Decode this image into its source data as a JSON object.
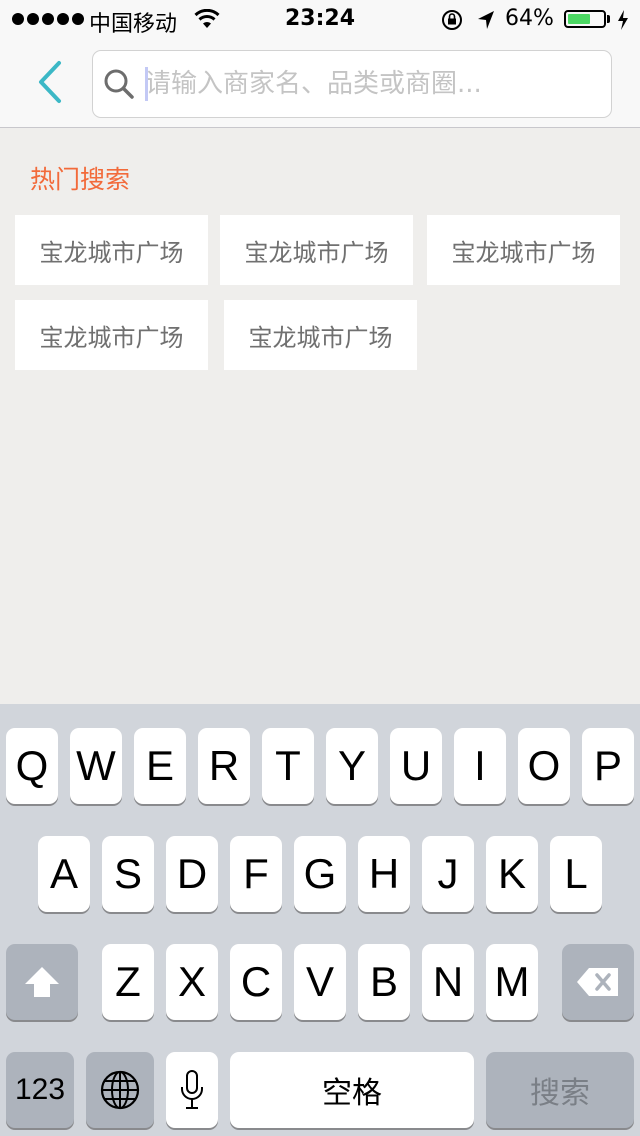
{
  "status_bar": {
    "carrier": "中国移动",
    "time": "23:24",
    "battery": "64%",
    "battery_level": 0.64,
    "battery_color": "#4cd964"
  },
  "search": {
    "placeholder": "请输入商家名、品类或商圈...",
    "value": ""
  },
  "hot_search": {
    "title": "热门搜索",
    "title_color": "#f26a3a",
    "tags": [
      "宝龙城市广场",
      "宝龙城市广场",
      "宝龙城市广场",
      "宝龙城市广场",
      "宝龙城市广场"
    ]
  },
  "keyboard": {
    "row1": [
      "Q",
      "W",
      "E",
      "R",
      "T",
      "Y",
      "U",
      "I",
      "O",
      "P"
    ],
    "row2": [
      "A",
      "S",
      "D",
      "F",
      "G",
      "H",
      "J",
      "K",
      "L"
    ],
    "row3": [
      "Z",
      "X",
      "C",
      "V",
      "B",
      "N",
      "M"
    ],
    "numbers_label": "123",
    "space_label": "空格",
    "search_label": "搜索"
  },
  "icons": {
    "back": "chevron-left-icon",
    "search": "magnifier-icon",
    "globe": "globe-icon",
    "mic": "microphone-icon",
    "shift": "shift-arrow-icon",
    "delete": "backspace-icon",
    "accent": "#3cb8c6"
  }
}
